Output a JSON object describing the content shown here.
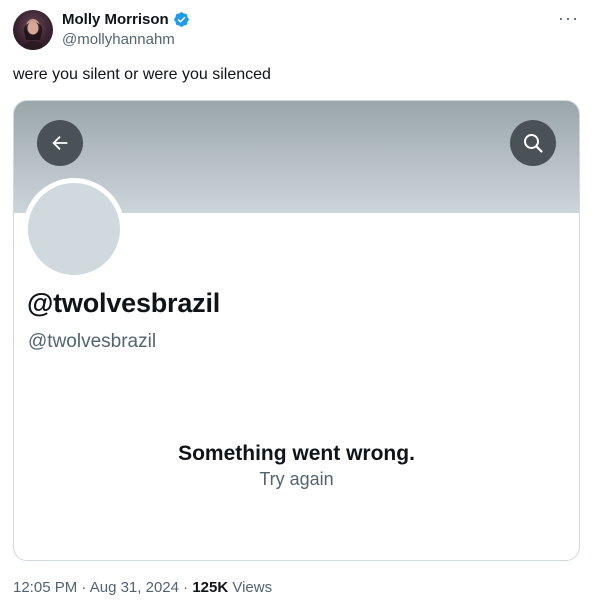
{
  "author": {
    "name": "Molly Morrison",
    "handle": "@mollyhannahm",
    "verified": true
  },
  "more_icon": "more-dots-icon",
  "tweet_text": "were you silent or were you silenced",
  "embedded_profile": {
    "display_name": "@twolvesbrazil",
    "handle": "@twolvesbrazil",
    "error_title": "Something went wrong.",
    "error_action": "Try again",
    "back_icon": "arrow-left-icon",
    "search_icon": "search-icon"
  },
  "footer": {
    "time": "12:05 PM",
    "date": "Aug 31, 2024",
    "views_count": "125K",
    "views_label": "Views",
    "separator": "·"
  },
  "colors": {
    "verified_blue": "#1d9bf0",
    "secondary_text": "#536471",
    "primary_text": "#0f1419"
  }
}
